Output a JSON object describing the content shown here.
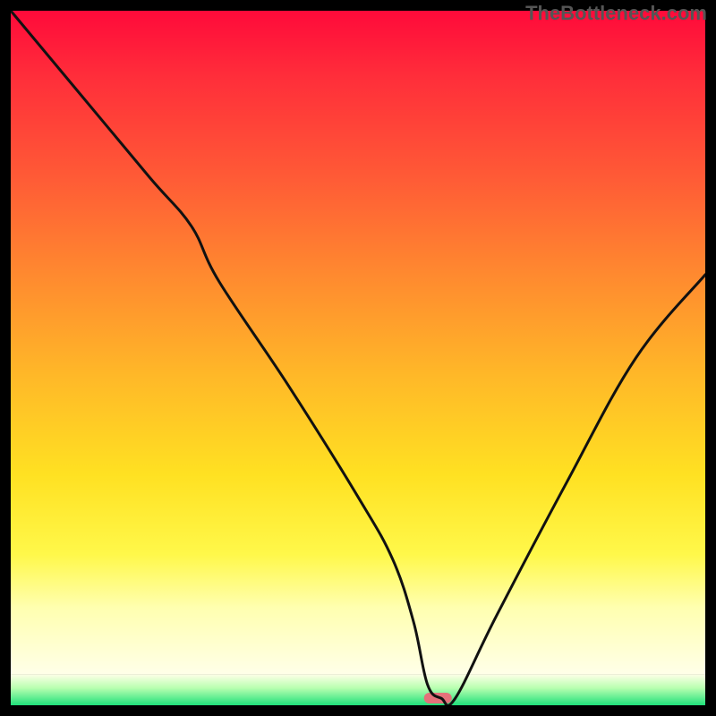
{
  "watermark": "TheBottleneck.com",
  "chart_data": {
    "type": "line",
    "title": "",
    "xlabel": "",
    "ylabel": "",
    "xlim": [
      0,
      100
    ],
    "ylim": [
      0,
      100
    ],
    "x": [
      0,
      10,
      20,
      26,
      30,
      40,
      50,
      55,
      58,
      60,
      62,
      64,
      70,
      80,
      90,
      100
    ],
    "values": [
      100,
      88,
      76,
      69,
      61,
      46,
      30,
      21,
      12,
      3,
      1,
      1,
      13,
      32,
      50,
      62
    ],
    "annotations": [],
    "background": {
      "upper_stops": [
        {
          "offset": 0.0,
          "color": "#ff0a3a"
        },
        {
          "offset": 0.1,
          "color": "#ff2e3a"
        },
        {
          "offset": 0.25,
          "color": "#ff5a36"
        },
        {
          "offset": 0.4,
          "color": "#ff8a2f"
        },
        {
          "offset": 0.55,
          "color": "#ffb828"
        },
        {
          "offset": 0.7,
          "color": "#ffe122"
        },
        {
          "offset": 0.82,
          "color": "#fff84a"
        },
        {
          "offset": 0.9,
          "color": "#ffffb0"
        },
        {
          "offset": 1.0,
          "color": "#ffffe8"
        }
      ],
      "lower_stops": [
        {
          "offset": 0.0,
          "color": "#ffffe8"
        },
        {
          "offset": 0.45,
          "color": "#b8ffb0"
        },
        {
          "offset": 1.0,
          "color": "#1fe07a"
        }
      ],
      "upper_fraction": 0.955,
      "lower_fraction": 0.045
    },
    "marker": {
      "x": 61.5,
      "width_pct": 4.0,
      "color": "#e4717a"
    },
    "line_color": "#111111",
    "line_width": 3
  }
}
